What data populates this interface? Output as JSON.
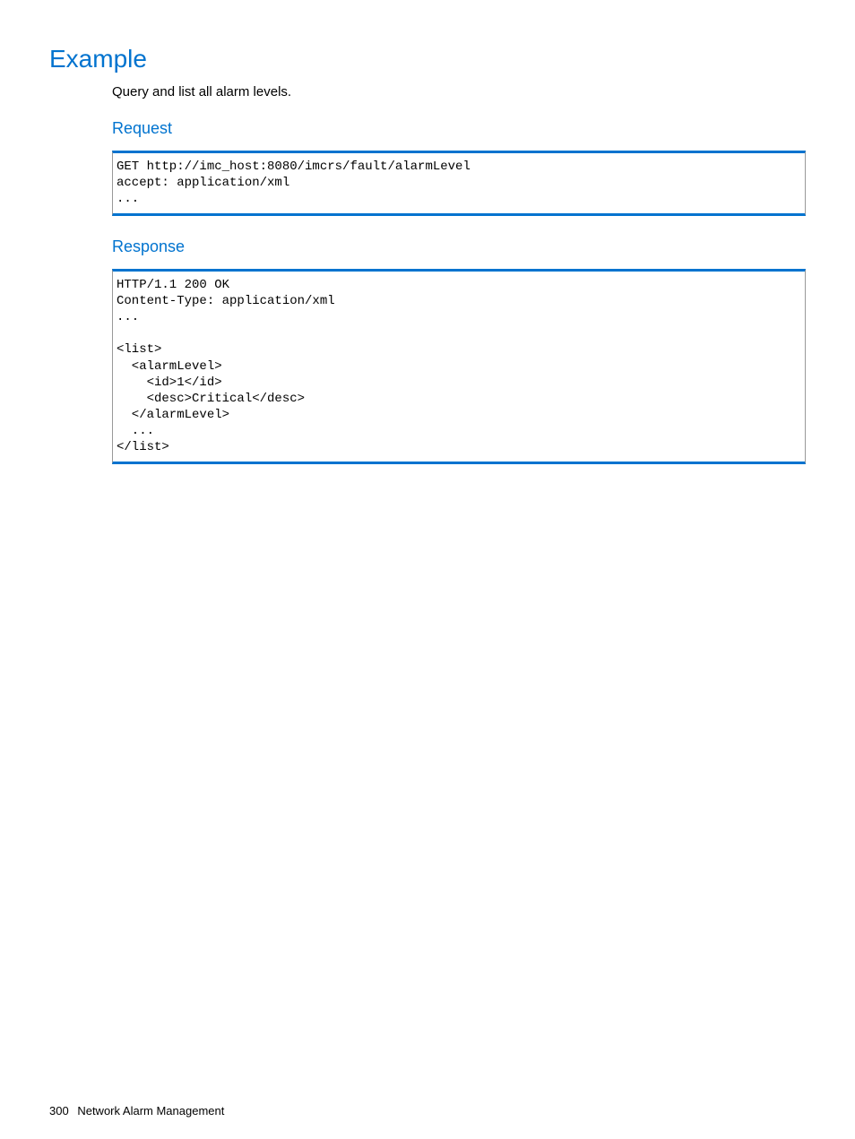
{
  "headings": {
    "example": "Example",
    "request": "Request",
    "response": "Response"
  },
  "description": "Query and list all alarm levels.",
  "request_code": "GET http://imc_host:8080/imcrs/fault/alarmLevel\naccept: application/xml\n...",
  "response_code": "HTTP/1.1 200 OK\nContent-Type: application/xml\n...\n\n<list>\n  <alarmLevel>\n    <id>1</id>\n    <desc>Critical</desc>\n  </alarmLevel>\n  ...\n</list>",
  "footer": {
    "page_number": "300",
    "section_title": "Network Alarm Management"
  }
}
